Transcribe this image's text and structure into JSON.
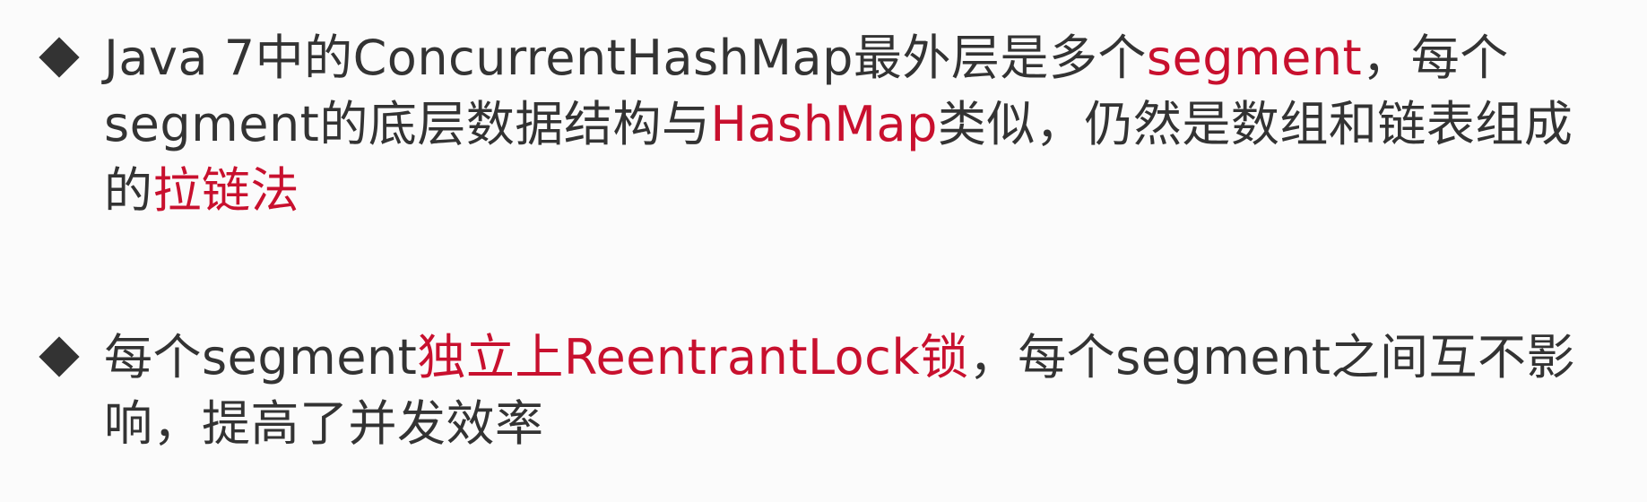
{
  "bullets": [
    {
      "parts": [
        {
          "text": "Java 7中的ConcurrentHashMap最外层是多个",
          "highlight": false
        },
        {
          "text": "segment",
          "highlight": true
        },
        {
          "text": "，每个segment的底层数据结构与",
          "highlight": false
        },
        {
          "text": "HashMap",
          "highlight": true
        },
        {
          "text": "类似，仍然是数组和链表组成的",
          "highlight": false
        },
        {
          "text": "拉链法",
          "highlight": true
        }
      ]
    },
    {
      "parts": [
        {
          "text": "每个segment",
          "highlight": false
        },
        {
          "text": "独立上ReentrantLock锁",
          "highlight": true
        },
        {
          "text": "，每个segment之间互不影响，提高了并发效率",
          "highlight": false
        }
      ]
    }
  ],
  "colors": {
    "text": "#333333",
    "highlight": "#c8102e",
    "background": "#fbfbfb"
  },
  "icons": {
    "bullet": "diamond-bullet-icon"
  }
}
